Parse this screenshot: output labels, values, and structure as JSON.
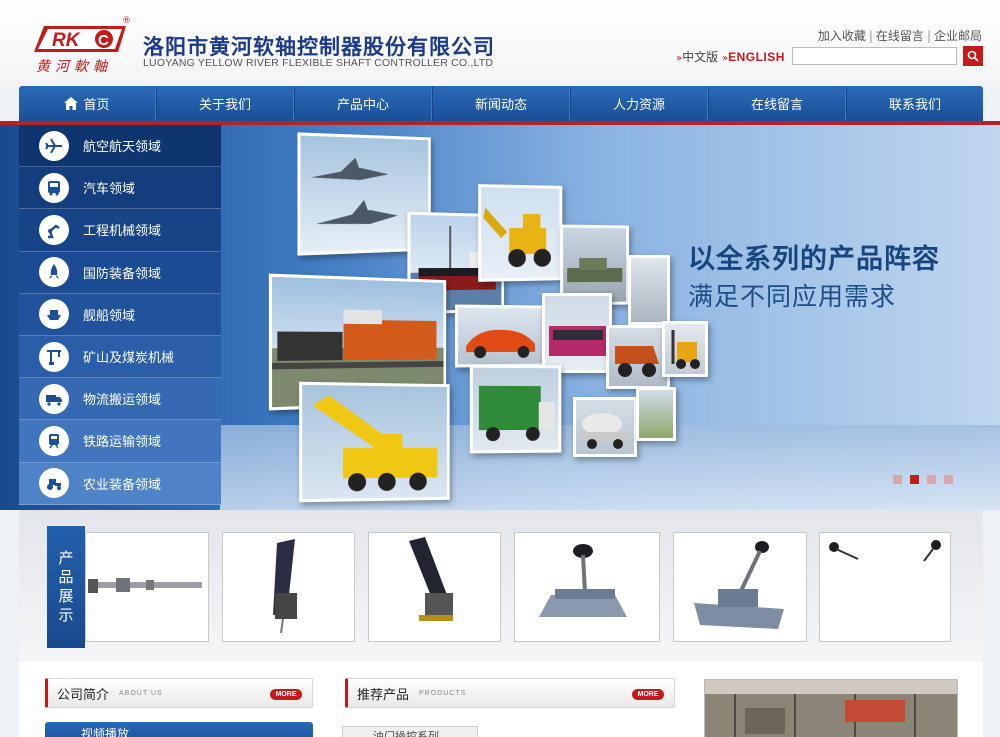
{
  "header": {
    "logo_text": "RK",
    "logo_subtitle": "黄河軟軸",
    "registered": "®",
    "company_cn": "洛阳市黄河软轴控制器股份有限公司",
    "company_en": "LUOYANG YELLOW RIVER FLEXIBLE SHAFT CONTROLLER CO.,LTD",
    "top_links": [
      "加入收藏",
      "在线留言",
      "企业邮局"
    ],
    "lang_cn": "中文版",
    "lang_en": "ENGLISH",
    "search_placeholder": ""
  },
  "nav": [
    "首页",
    "关于我们",
    "产品中心",
    "新闻动态",
    "人力资源",
    "在线留言",
    "联系我们"
  ],
  "sidebar": [
    {
      "label": "航空航天领域",
      "icon": "airplane-icon"
    },
    {
      "label": "汽车领域",
      "icon": "bus-icon"
    },
    {
      "label": "工程机械领域",
      "icon": "robot-arm-icon"
    },
    {
      "label": "国防装备领域",
      "icon": "rocket-icon"
    },
    {
      "label": "舰船领域",
      "icon": "ship-icon"
    },
    {
      "label": "矿山及煤炭机械",
      "icon": "crane-icon"
    },
    {
      "label": "物流搬运领域",
      "icon": "truck-icon"
    },
    {
      "label": "铁路运输领域",
      "icon": "train-icon"
    },
    {
      "label": "农业装备领域",
      "icon": "tractor-icon"
    }
  ],
  "banner": {
    "slogan_line1": "以全系列的产品阵容",
    "slogan_line2": "满足不同应用需求",
    "slide_count": 4,
    "active_slide": 2
  },
  "products": {
    "tab_label": [
      "产",
      "品",
      "展",
      "示"
    ]
  },
  "sections": {
    "about_title": "公司简介",
    "about_sub": "ABOUT US",
    "recommend_title": "推荐产品",
    "recommend_sub": "PRODUCTS",
    "more": "MORE",
    "video_title": "视频播放",
    "product_tab": "油门操控系列"
  },
  "colors": {
    "brand_blue": "#1b4f98",
    "brand_red": "#c41a1a"
  }
}
